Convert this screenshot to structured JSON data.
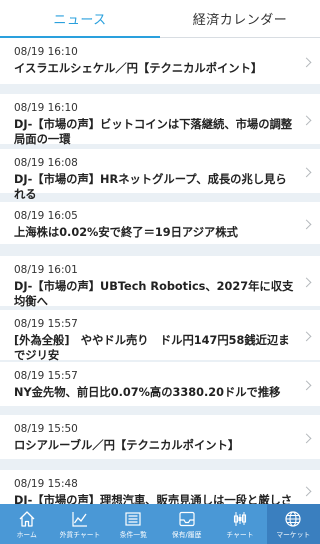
{
  "tabs": [
    {
      "label": "ニュース",
      "active": true
    },
    {
      "label": "経済カレンダー",
      "active": false
    }
  ],
  "news": [
    {
      "time": "08/19 16:10",
      "title": "イスラエルシェケル／円【テクニカルポイント】"
    },
    {
      "time": "08/19 16:10",
      "title": "DJ-【市場の声】ビットコインは下落継続、市場の調整局面の一環"
    },
    {
      "time": "08/19 16:08",
      "title": "DJ-【市場の声】HRネットグループ、成長の兆し見られる"
    },
    {
      "time": "08/19 16:05",
      "title": "上海株は0.02%安で終了＝19日アジア株式"
    },
    {
      "time": "08/19 16:01",
      "title": "DJ-【市場の声】UBTech Robotics、2027年に収支均衡へ"
    },
    {
      "time": "08/19 15:57",
      "title": "[外為全般]　ややドル売り　ドル円147円58銭近辺までジリ安"
    },
    {
      "time": "08/19 15:57",
      "title": "NY金先物、前日比0.07%高の3380.20ドルで推移"
    },
    {
      "time": "08/19 15:50",
      "title": "ロシアルーブル／円【テクニカルポイント】"
    },
    {
      "time": "08/19 15:48",
      "title": "DJ-【市場の声】理想汽車、販売見通しは一段と厳しさ"
    }
  ],
  "bottom_nav": [
    {
      "label": "ホーム",
      "icon": "home-icon"
    },
    {
      "label": "外貨チャート",
      "icon": "fx-chart-icon"
    },
    {
      "label": "条件一覧",
      "icon": "list-icon"
    },
    {
      "label": "保有/履歴",
      "icon": "inbox-icon"
    },
    {
      "label": "チャート",
      "icon": "candlestick-icon"
    },
    {
      "label": "マーケット",
      "icon": "globe-icon",
      "active": true
    }
  ],
  "colors": {
    "accent": "#2aa0dd",
    "nav_bg": "#4a98d6",
    "nav_active_bg": "#3a7fbf",
    "list_bg": "#eaf0f5"
  }
}
